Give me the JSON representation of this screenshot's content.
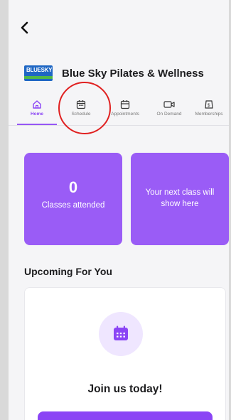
{
  "header": {
    "studio_name": "Blue Sky Pilates & Wellness",
    "logo_text": "BLUESKY"
  },
  "tabs": [
    {
      "label": "Home",
      "icon": "home-icon",
      "active": true
    },
    {
      "label": "Schedule",
      "icon": "calendar-icon",
      "active": false
    },
    {
      "label": "Appointments",
      "icon": "appointments-icon",
      "active": false
    },
    {
      "label": "On Demand",
      "icon": "video-icon",
      "active": false
    },
    {
      "label": "Memberships",
      "icon": "membership-icon",
      "active": false
    }
  ],
  "stats": {
    "classes_attended_value": "0",
    "classes_attended_label": "Classes attended",
    "next_class_label": "Your next class will show here"
  },
  "upcoming": {
    "title": "Upcoming For You",
    "join_text": "Join us today!"
  },
  "colors": {
    "accent": "#9a5cf6",
    "annotation": "#e02020"
  }
}
